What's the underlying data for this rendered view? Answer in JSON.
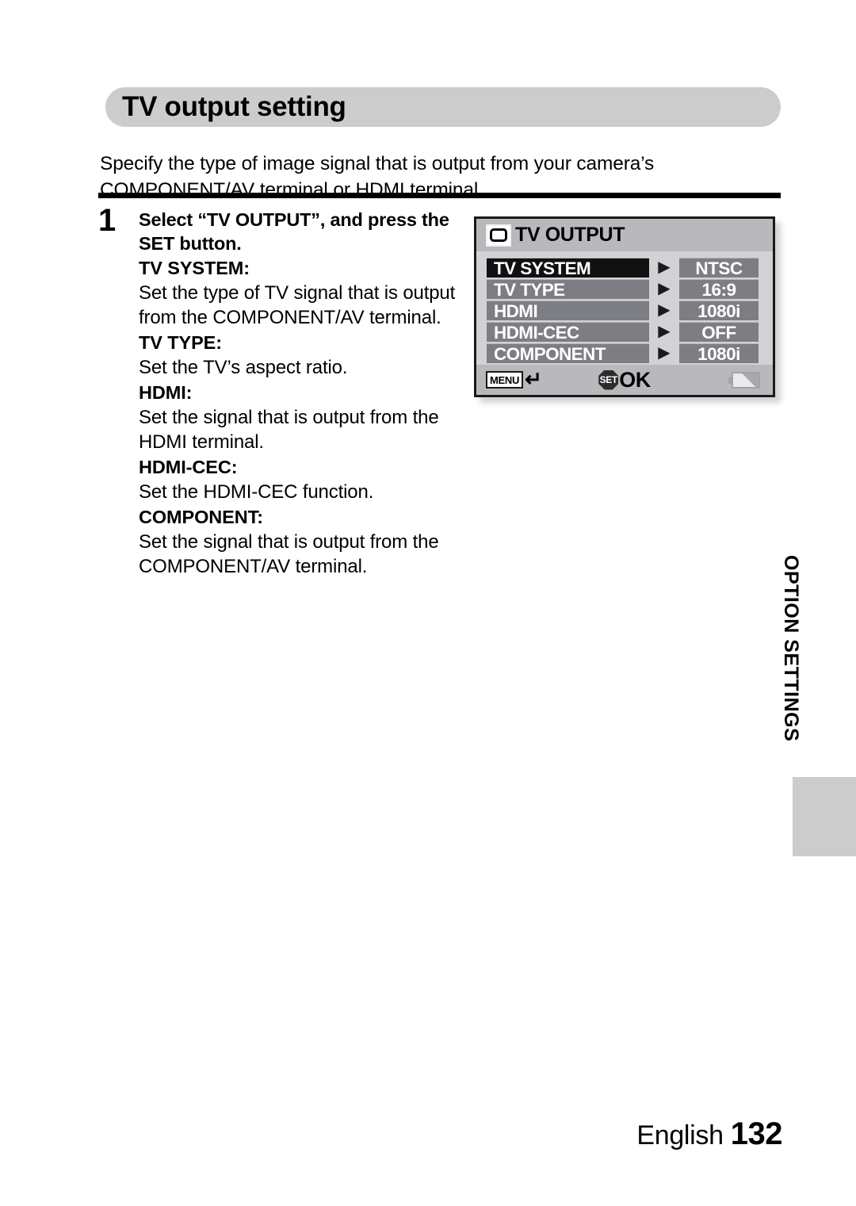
{
  "page": {
    "title": "TV output setting",
    "intro": "Specify the type of image signal that is output from your camera’s COMPONENT/AV terminal or HDMI terminal.",
    "side_tab": "OPTION SETTINGS",
    "footer_language": "English",
    "footer_page_number": "132"
  },
  "step": {
    "number": "1",
    "lead": "Select “TV OUTPUT”, and press the SET button.",
    "definitions": [
      {
        "term": "TV SYSTEM:",
        "desc": "Set the type of TV signal that is output from the COMPONENT/AV terminal."
      },
      {
        "term": "TV TYPE:",
        "desc": "Set the TV’s aspect ratio."
      },
      {
        "term": "HDMI:",
        "desc": "Set the signal that is output from the HDMI terminal."
      },
      {
        "term": "HDMI-CEC:",
        "desc": "Set the HDMI-CEC function."
      },
      {
        "term": "COMPONENT:",
        "desc": "Set the signal that is output from the COMPONENT/AV terminal."
      }
    ]
  },
  "lcd": {
    "header_title": "TV OUTPUT",
    "header_icon": "tv-monitor-icon",
    "rows": [
      {
        "label": "TV SYSTEM",
        "value": "NTSC",
        "selected": true
      },
      {
        "label": "TV TYPE",
        "value": "16:9",
        "selected": false
      },
      {
        "label": "HDMI",
        "value": "1080i",
        "selected": false
      },
      {
        "label": "HDMI-CEC",
        "value": "OFF",
        "selected": false
      },
      {
        "label": "COMPONENT",
        "value": "1080i",
        "selected": false
      }
    ],
    "arrow_glyph": "▶",
    "footer": {
      "menu_label": "MENU",
      "menu_return_glyph": "↵",
      "set_label": "SET",
      "ok_label": "OK",
      "battery_icon": "battery-icon"
    }
  },
  "colors": {
    "banner_gray": "#cccccc",
    "lcd_body": "#d2d2d6",
    "lcd_bar": "#b9b9bd",
    "row_gray": "#7d7d84",
    "row_selected": "#111111"
  }
}
